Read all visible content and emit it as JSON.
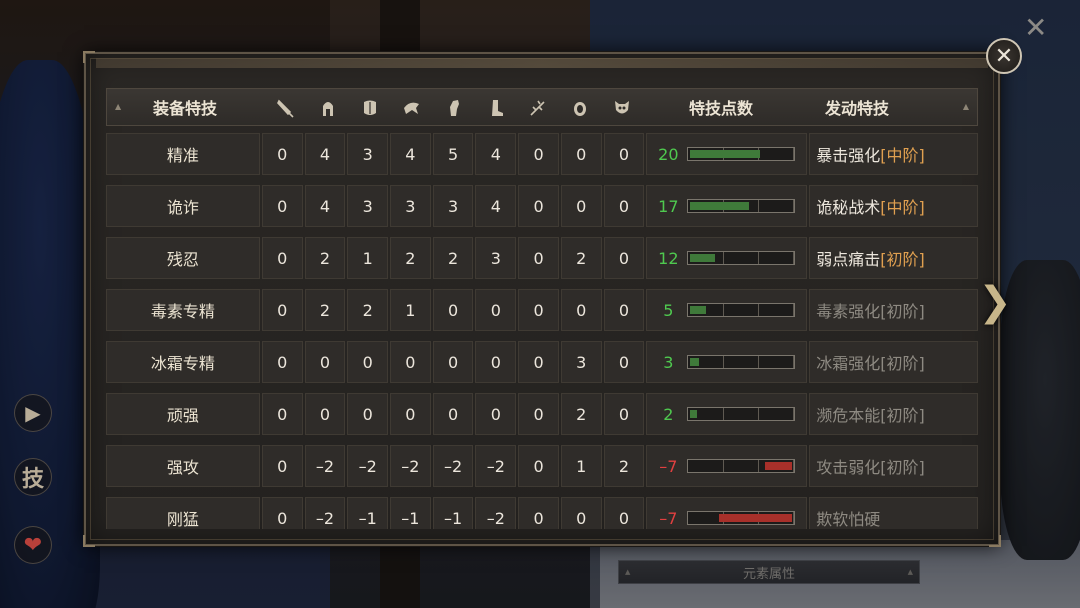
{
  "header": {
    "name_label": "装备特技",
    "points_label": "特技点数",
    "skill_label": "发动特技",
    "slot_icons": [
      "dagger-icon",
      "helmet-icon",
      "chest-armor-icon",
      "shoulder-icon",
      "glove-icon",
      "boot-icon",
      "branch-icon",
      "ring-icon",
      "mask-icon"
    ]
  },
  "rows": [
    {
      "name": "精准",
      "values": [
        "0",
        "4",
        "3",
        "4",
        "5",
        "4",
        "0",
        "0",
        "0"
      ],
      "points": "20",
      "points_color": "#4fc94f",
      "fill_fraction": 0.67,
      "fill_color": "#3f7a3a",
      "skill": "暴击强化",
      "tier": "[中阶]",
      "active": true
    },
    {
      "name": "诡诈",
      "values": [
        "0",
        "4",
        "3",
        "3",
        "3",
        "4",
        "0",
        "0",
        "0"
      ],
      "points": "17",
      "points_color": "#4fc94f",
      "fill_fraction": 0.57,
      "fill_color": "#3f7a3a",
      "skill": "诡秘战术",
      "tier": "[中阶]",
      "active": true
    },
    {
      "name": "残忍",
      "values": [
        "0",
        "2",
        "1",
        "2",
        "2",
        "3",
        "0",
        "2",
        "0"
      ],
      "points": "12",
      "points_color": "#4fc94f",
      "fill_fraction": 0.24,
      "fill_color": "#3f7a3a",
      "skill": "弱点痛击",
      "tier": "[初阶]",
      "active": true
    },
    {
      "name": "毒素专精",
      "values": [
        "0",
        "2",
        "2",
        "1",
        "0",
        "0",
        "0",
        "0",
        "0"
      ],
      "points": "5",
      "points_color": "#4fc94f",
      "fill_fraction": 0.15,
      "fill_color": "#3f7a3a",
      "skill": "毒素强化",
      "tier": "[初阶]",
      "active": false
    },
    {
      "name": "冰霜专精",
      "values": [
        "0",
        "0",
        "0",
        "0",
        "0",
        "0",
        "0",
        "3",
        "0"
      ],
      "points": "3",
      "points_color": "#4fc94f",
      "fill_fraction": 0.09,
      "fill_color": "#3f7a3a",
      "skill": "冰霜强化",
      "tier": "[初阶]",
      "active": false
    },
    {
      "name": "顽强",
      "values": [
        "0",
        "0",
        "0",
        "0",
        "0",
        "0",
        "0",
        "2",
        "0"
      ],
      "points": "2",
      "points_color": "#4fc94f",
      "fill_fraction": 0.07,
      "fill_color": "#3f7a3a",
      "skill": "濒危本能",
      "tier": "[初阶]",
      "active": false
    },
    {
      "name": "强攻",
      "values": [
        "0",
        "–2",
        "–2",
        "–2",
        "–2",
        "–2",
        "0",
        "1",
        "2"
      ],
      "points": "–7",
      "points_color": "#e04040",
      "fill_fraction": 0.26,
      "fill_color": "#a8302a",
      "skill": "攻击弱化",
      "tier": "[初阶]",
      "active": false
    },
    {
      "name": "刚猛",
      "values": [
        "0",
        "–2",
        "–1",
        "–1",
        "–1",
        "–2",
        "0",
        "0",
        "0"
      ],
      "points": "–7",
      "points_color": "#e04040",
      "fill_fraction": 0.7,
      "fill_color": "#a8302a",
      "skill": "欺软怕硬",
      "tier": "",
      "active": false
    }
  ],
  "side": {
    "arrow": "▶",
    "skill_char": "技",
    "heart": "❤"
  },
  "close_symbol": "✕",
  "top_close": "✕",
  "next_symbol": "❯",
  "bottom_tab": "元素属性"
}
